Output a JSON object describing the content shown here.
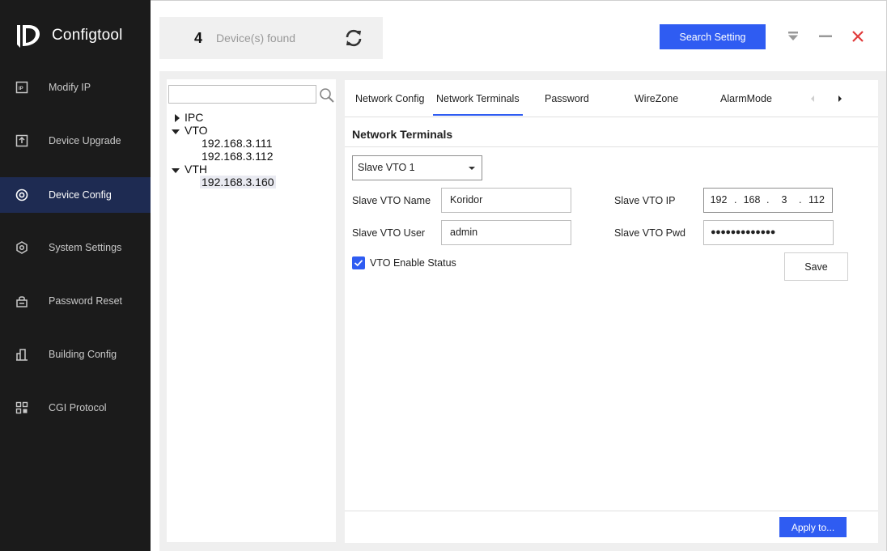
{
  "app": {
    "title": "Configtool",
    "logo_icon": "configtool-logo-icon"
  },
  "sidebar": {
    "items": [
      {
        "label": "Modify IP",
        "icon": "ip-icon"
      },
      {
        "label": "Device Upgrade",
        "icon": "upgrade-icon"
      },
      {
        "label": "Device Config",
        "icon": "config-target-icon",
        "active": true
      },
      {
        "label": "System Settings",
        "icon": "hexagon-settings-icon"
      },
      {
        "label": "Password Reset",
        "icon": "lock-icon"
      },
      {
        "label": "Building Config",
        "icon": "building-icon"
      },
      {
        "label": "CGI Protocol",
        "icon": "grid-icon"
      }
    ]
  },
  "header": {
    "device_count": "4",
    "found_label": "Device(s) found",
    "search_setting_label": "Search Setting"
  },
  "tree": {
    "search_placeholder": "",
    "groups": [
      {
        "label": "IPC",
        "expanded": false,
        "children": []
      },
      {
        "label": "VTO",
        "expanded": true,
        "children": [
          "192.168.3.111",
          "192.168.3.112"
        ]
      },
      {
        "label": "VTH",
        "expanded": true,
        "children": [
          "192.168.3.160"
        ]
      }
    ],
    "selected": "192.168.3.160"
  },
  "tabs": [
    {
      "label": "Network Config"
    },
    {
      "label": "Network Terminals",
      "active": true
    },
    {
      "label": "Password"
    },
    {
      "label": "WireZone"
    },
    {
      "label": "AlarmMode"
    }
  ],
  "form": {
    "section_title": "Network Terminals",
    "slave_select": "Slave VTO 1",
    "name_label": "Slave VTO Name",
    "name_value": "Koridor",
    "user_label": "Slave VTO User",
    "user_value": "admin",
    "ip_label": "Slave VTO IP",
    "ip_parts": [
      "192",
      "168",
      "3",
      "112"
    ],
    "pwd_label": "Slave VTO Pwd",
    "pwd_value": "●●●●●●●●●●●●●",
    "enable_label": "VTO Enable Status",
    "enable_checked": true,
    "save_label": "Save",
    "apply_label": "Apply to..."
  },
  "colors": {
    "accent": "#2f5cf2",
    "sidebar_bg": "#1b1b1b",
    "sidebar_active": "#1e2b52",
    "close": "#e03b3b"
  }
}
